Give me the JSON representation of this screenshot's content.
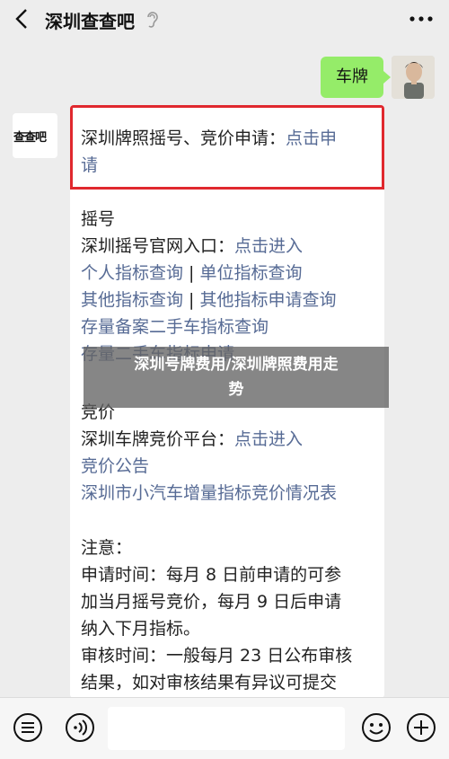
{
  "header": {
    "title": "深圳查查吧"
  },
  "user_message": {
    "text": "车牌"
  },
  "bot": {
    "avatar_text": "查查吧"
  },
  "card": {
    "highlight": {
      "line1_text": "深圳牌照摇号、竞价申请：",
      "line1_link": "点击申",
      "line2_link": "请"
    },
    "yaohao_heading": "摇号",
    "yaohao_official_text": "深圳摇号官网入口：",
    "yaohao_official_link": "点击进入",
    "personal_query": "个人指标查询",
    "unit_query": "单位指标查询",
    "other_query": "其他指标查询",
    "other_apply_query": "其他指标申请查询",
    "stock_query": "存量备案二手车指标查询",
    "partial_line": "存量二手车指标申请",
    "jingjia_heading": "竞价",
    "jingjia_platform_text": "深圳车牌竞价平台：",
    "jingjia_platform_link": "点击进入",
    "jingjia_notice": "竞价公告",
    "jingjia_situation": "深圳市小汽车增量指标竞价情况表",
    "note_heading": "注意：",
    "note_line1": "申请时间：每月 8 日前申请的可参",
    "note_line2": "加当月摇号竞价，每月 9 日后申请",
    "note_line3": "纳入下月指标。",
    "note_line4": "审核时间：一般每月 23 日公布审核",
    "note_line5": "结果，如对审核结果有异议可提交"
  },
  "overlay": {
    "line1": "深圳号牌费用/深圳牌照费用走",
    "line2": "势"
  },
  "colors": {
    "link": "#576b95",
    "bubble": "#95ec69",
    "highlight_border": "#e0282e"
  },
  "icons": [
    "back-icon",
    "ear-icon",
    "more-icon",
    "menu-icon",
    "voice-icon",
    "emoji-icon",
    "add-icon"
  ]
}
